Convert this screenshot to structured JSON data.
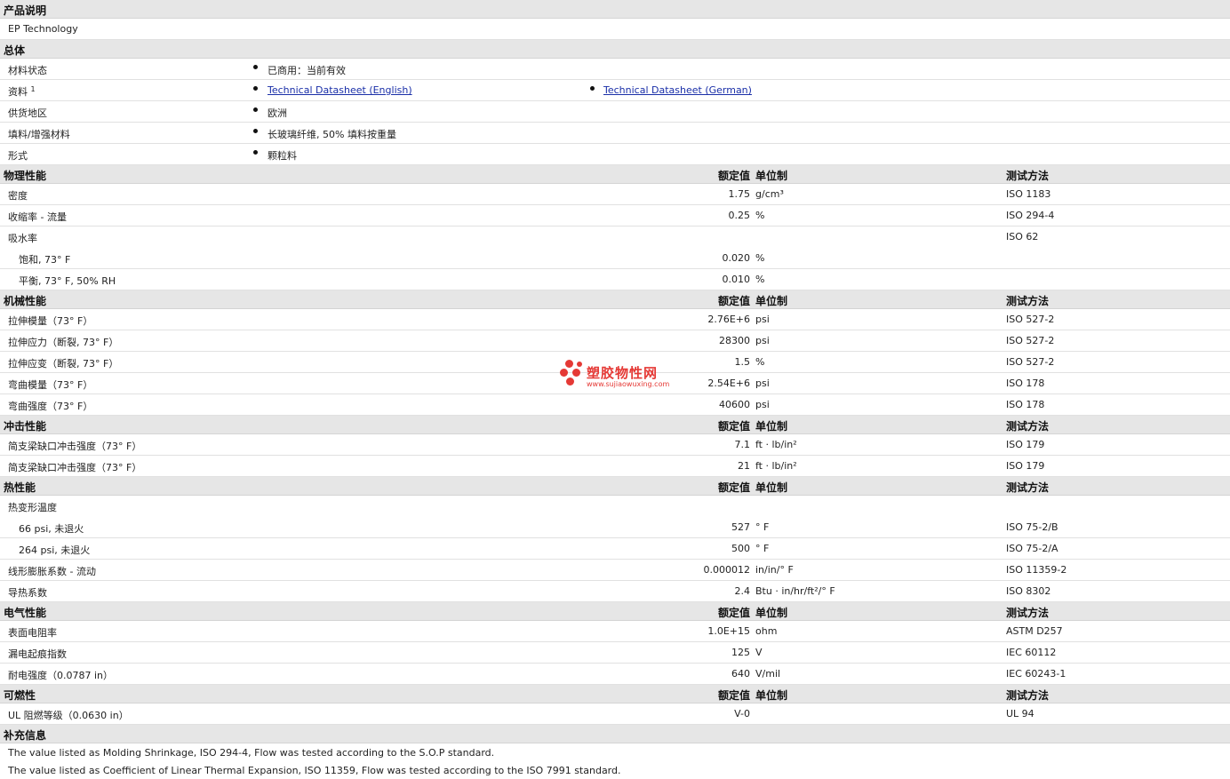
{
  "product": {
    "title": "产品说明",
    "description": "EP Technology"
  },
  "general": {
    "title": "总体",
    "rows": [
      {
        "label": "材料状态",
        "v1": "已商用：当前有效"
      },
      {
        "label": "资料",
        "sup": "1",
        "link1": "Technical Datasheet (English)",
        "link2": "Technical Datasheet (German)"
      },
      {
        "label": "供货地区",
        "v1": "欧洲"
      },
      {
        "label": "填料/增强材料",
        "v1": "长玻璃纤维, 50% 填料按重量"
      },
      {
        "label": "形式",
        "v1": "颗粒料"
      }
    ]
  },
  "headers": {
    "value": "额定值",
    "unit": "单位制",
    "test": "测试方法"
  },
  "sections": {
    "physical": {
      "title": "物理性能",
      "rows": [
        {
          "label": "密度",
          "value": "1.75",
          "unit": "g/cm³",
          "test": "ISO 1183"
        },
        {
          "label": "收缩率  - 流量",
          "value": "0.25",
          "unit": "%",
          "test": "ISO 294-4"
        },
        {
          "label": "吸水率",
          "value": "",
          "unit": "",
          "test": "ISO 62"
        },
        {
          "label": "饱和, 73° F",
          "value": "0.020",
          "unit": "%",
          "test": ""
        },
        {
          "label": "平衡, 73° F, 50% RH",
          "value": "0.010",
          "unit": "%",
          "test": ""
        }
      ]
    },
    "mechanical": {
      "title": "机械性能",
      "rows": [
        {
          "label": "拉伸模量（73° F）",
          "value": "2.76E+6",
          "unit": "psi",
          "test": "ISO 527-2"
        },
        {
          "label": "拉伸应力（断裂, 73° F）",
          "value": "28300",
          "unit": "psi",
          "test": "ISO 527-2"
        },
        {
          "label": "拉伸应变（断裂, 73° F）",
          "value": "1.5",
          "unit": "%",
          "test": "ISO 527-2"
        },
        {
          "label": "弯曲模量（73° F）",
          "value": "2.54E+6",
          "unit": "psi",
          "test": "ISO 178"
        },
        {
          "label": "弯曲强度（73° F）",
          "value": "40600",
          "unit": "psi",
          "test": "ISO 178"
        }
      ]
    },
    "impact": {
      "title": "冲击性能",
      "rows": [
        {
          "label": "简支梁缺口冲击强度（73° F）",
          "value": "7.1",
          "unit": "ft · lb/in²",
          "test": "ISO 179"
        },
        {
          "label": "简支梁缺口冲击强度（73° F）",
          "value": "21",
          "unit": "ft · lb/in²",
          "test": "ISO 179"
        }
      ]
    },
    "thermal": {
      "title": "热性能",
      "rows": [
        {
          "label": "热变形温度",
          "value": "",
          "unit": "",
          "test": ""
        },
        {
          "label": "66 psi, 未退火",
          "value": "527",
          "unit": "° F",
          "test": "ISO 75-2/B"
        },
        {
          "label": "264 psi, 未退火",
          "value": "500",
          "unit": "° F",
          "test": "ISO 75-2/A"
        },
        {
          "label": "线形膨胀系数  - 流动",
          "value": "0.000012",
          "unit": "in/in/° F",
          "test": "ISO 11359-2"
        },
        {
          "label": "导热系数",
          "value": "2.4",
          "unit": "Btu · in/hr/ft²/° F",
          "test": "ISO 8302"
        }
      ]
    },
    "electrical": {
      "title": "电气性能",
      "rows": [
        {
          "label": "表面电阻率",
          "value": "1.0E+15",
          "unit": "ohm",
          "test": "ASTM D257"
        },
        {
          "label": "漏电起痕指数",
          "value": "125",
          "unit": "V",
          "test": "IEC 60112"
        },
        {
          "label": "耐电强度（0.0787 in）",
          "value": "640",
          "unit": "V/mil",
          "test": "IEC 60243-1"
        }
      ]
    },
    "flammability": {
      "title": "可燃性",
      "rows": [
        {
          "label": "UL 阻燃等级（0.0630 in）",
          "value": "V-0",
          "unit": "",
          "test": "UL 94"
        }
      ]
    }
  },
  "supplement": {
    "title": "补充信息",
    "notes": [
      "The value listed as Molding Shrinkage, ISO 294-4, Flow was tested according to the S.O.P standard.",
      "The value listed as Coefficient of Linear Thermal Expansion, ISO 11359, Flow was tested according to the ISO 7991 standard."
    ]
  },
  "watermark": {
    "name": "塑胶物性网",
    "url": "www.sujiaowuxing.com",
    "color": "#e53935"
  }
}
